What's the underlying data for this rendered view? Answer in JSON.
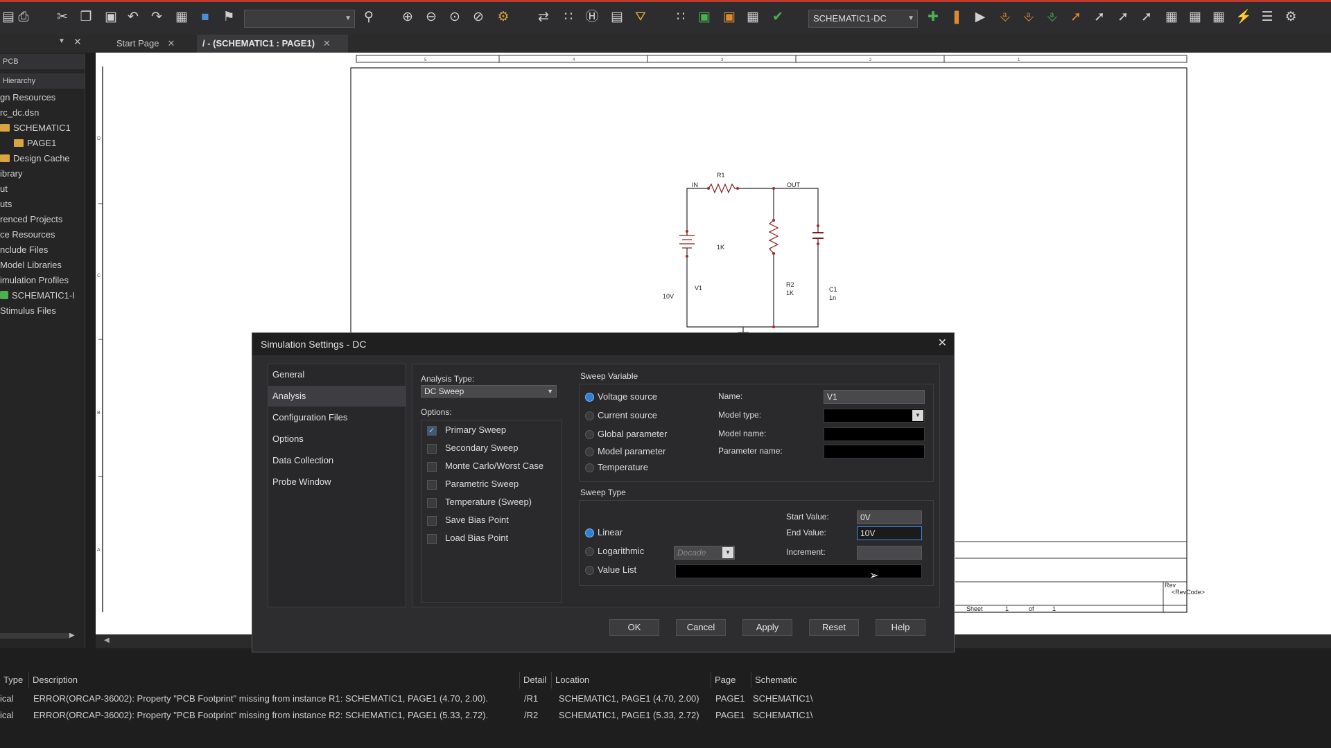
{
  "toolbar": {
    "layout_combo_value": "",
    "profile_combo_value": "SCHEMATIC1-DC"
  },
  "tabs": [
    {
      "label": "Start Page"
    },
    {
      "label": "/ - (SCHEMATIC1 : PAGE1)"
    }
  ],
  "left_panel": {
    "header1": "PCB",
    "header2": "Hierarchy",
    "items": [
      "gn Resources",
      "rc_dc.dsn",
      "SCHEMATIC1",
      "PAGE1",
      "Design Cache",
      "ibrary",
      "ut",
      "uts",
      "renced Projects",
      "ce Resources",
      "nclude Files",
      "Model Libraries",
      "imulation Profiles",
      "SCHEMATIC1-I",
      "Stimulus Files"
    ]
  },
  "schematic": {
    "border_cols": [
      "5",
      "4",
      "3",
      "2",
      "1"
    ],
    "border_rows": [
      "D",
      "C",
      "B",
      "A"
    ],
    "net_in": "IN",
    "net_out": "OUT",
    "r1_name": "R1",
    "r1_value": "1K",
    "r2_name": "R2",
    "r2_value": "1K",
    "c1_name": "C1",
    "c1_value": "1n",
    "v1_name": "V1",
    "v1_value": "10V",
    "title_rev": "Rev",
    "title_revcode": "<RevCode>",
    "title_sheet": "Sheet",
    "title_sheet_num": "1",
    "title_of": "of",
    "title_sheet_total": "1"
  },
  "dialog": {
    "title": "Simulation Settings - DC",
    "categories": [
      "General",
      "Analysis",
      "Configuration Files",
      "Options",
      "Data Collection",
      "Probe Window"
    ],
    "selected_category": "Analysis",
    "analysis_type_label": "Analysis Type:",
    "analysis_type_value": "DC Sweep",
    "options_label": "Options:",
    "options": [
      {
        "label": "Primary Sweep",
        "checked": true
      },
      {
        "label": "Secondary Sweep",
        "checked": false
      },
      {
        "label": "Monte Carlo/Worst Case",
        "checked": false
      },
      {
        "label": "Parametric Sweep",
        "checked": false
      },
      {
        "label": "Temperature (Sweep)",
        "checked": false
      },
      {
        "label": "Save Bias Point",
        "checked": false
      },
      {
        "label": "Load Bias Point",
        "checked": false
      }
    ],
    "sweep_variable_label": "Sweep Variable",
    "sweep_variable_options": [
      {
        "label": "Voltage source",
        "selected": true
      },
      {
        "label": "Current source",
        "selected": false
      },
      {
        "label": "Global parameter",
        "selected": false
      },
      {
        "label": "Model parameter",
        "selected": false
      },
      {
        "label": "Temperature",
        "selected": false
      }
    ],
    "name_label": "Name:",
    "name_value": "V1",
    "model_type_label": "Model type:",
    "model_type_value": "",
    "model_name_label": "Model name:",
    "model_name_value": "",
    "parameter_name_label": "Parameter name:",
    "parameter_name_value": "",
    "sweep_type_label": "Sweep Type",
    "sweep_type_options": [
      {
        "label": "Linear",
        "selected": true
      },
      {
        "label": "Logarithmic",
        "selected": false
      },
      {
        "label": "Value List",
        "selected": false
      }
    ],
    "log_scale_value": "Decade",
    "start_value_label": "Start Value:",
    "start_value": "0V",
    "end_value_label": "End Value:",
    "end_value": "10V",
    "increment_label": "Increment:",
    "increment_value": "",
    "value_list_value": "",
    "buttons": [
      "OK",
      "Cancel",
      "Apply",
      "Reset",
      "Help"
    ]
  },
  "messages": {
    "columns": [
      "Type",
      "Description",
      "Detail",
      "Location",
      "Page",
      "Schematic"
    ],
    "rows": [
      {
        "type": "ical",
        "description": "ERROR(ORCAP-36002): Property \"PCB Footprint\" missing from instance R1: SCHEMATIC1, PAGE1 (4.70, 2.00).",
        "detail": "/R1",
        "location": "SCHEMATIC1, PAGE1  (4.70, 2.00)",
        "page": "PAGE1",
        "schematic": "SCHEMATIC1\\"
      },
      {
        "type": "ical",
        "description": "ERROR(ORCAP-36002): Property \"PCB Footprint\" missing from instance R2: SCHEMATIC1, PAGE1 (5.33, 2.72).",
        "detail": "/R2",
        "location": "SCHEMATIC1, PAGE1  (5.33, 2.72)",
        "page": "PAGE1",
        "schematic": "SCHEMATIC1\\"
      }
    ]
  },
  "colors": {
    "accent": "#c0392b",
    "selection_blue": "#2f7fd6",
    "folder": "#d9a441"
  }
}
